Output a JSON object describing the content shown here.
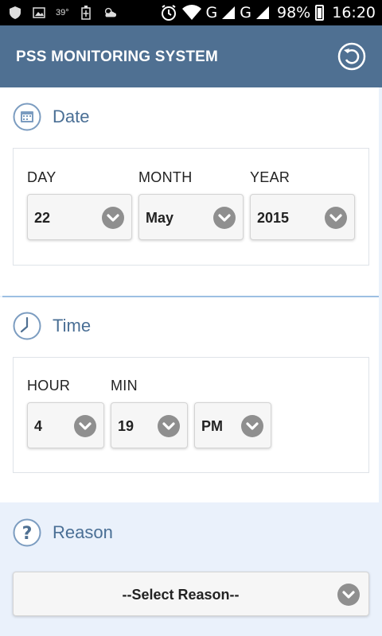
{
  "status_bar": {
    "temperature": "39°",
    "network_1": "G",
    "network_2": "G",
    "battery": "98%",
    "time": "16:20"
  },
  "app": {
    "title": "PSS MONITORING SYSTEM",
    "header_color": "#4f7092",
    "accent_color": "#4a6f95"
  },
  "date_section": {
    "heading": "Date",
    "icon": "calendar-icon",
    "fields": [
      {
        "label": "DAY",
        "value": "22"
      },
      {
        "label": "MONTH",
        "value": "May"
      },
      {
        "label": "YEAR",
        "value": "2015"
      }
    ]
  },
  "time_section": {
    "heading": "Time",
    "icon": "clock-icon",
    "fields": [
      {
        "label": "HOUR",
        "value": "4"
      },
      {
        "label": "MIN",
        "value": "19"
      },
      {
        "label": "",
        "value": "PM"
      }
    ]
  },
  "reason_section": {
    "heading": "Reason",
    "icon": "question-icon",
    "select_value": "--Select Reason--"
  }
}
